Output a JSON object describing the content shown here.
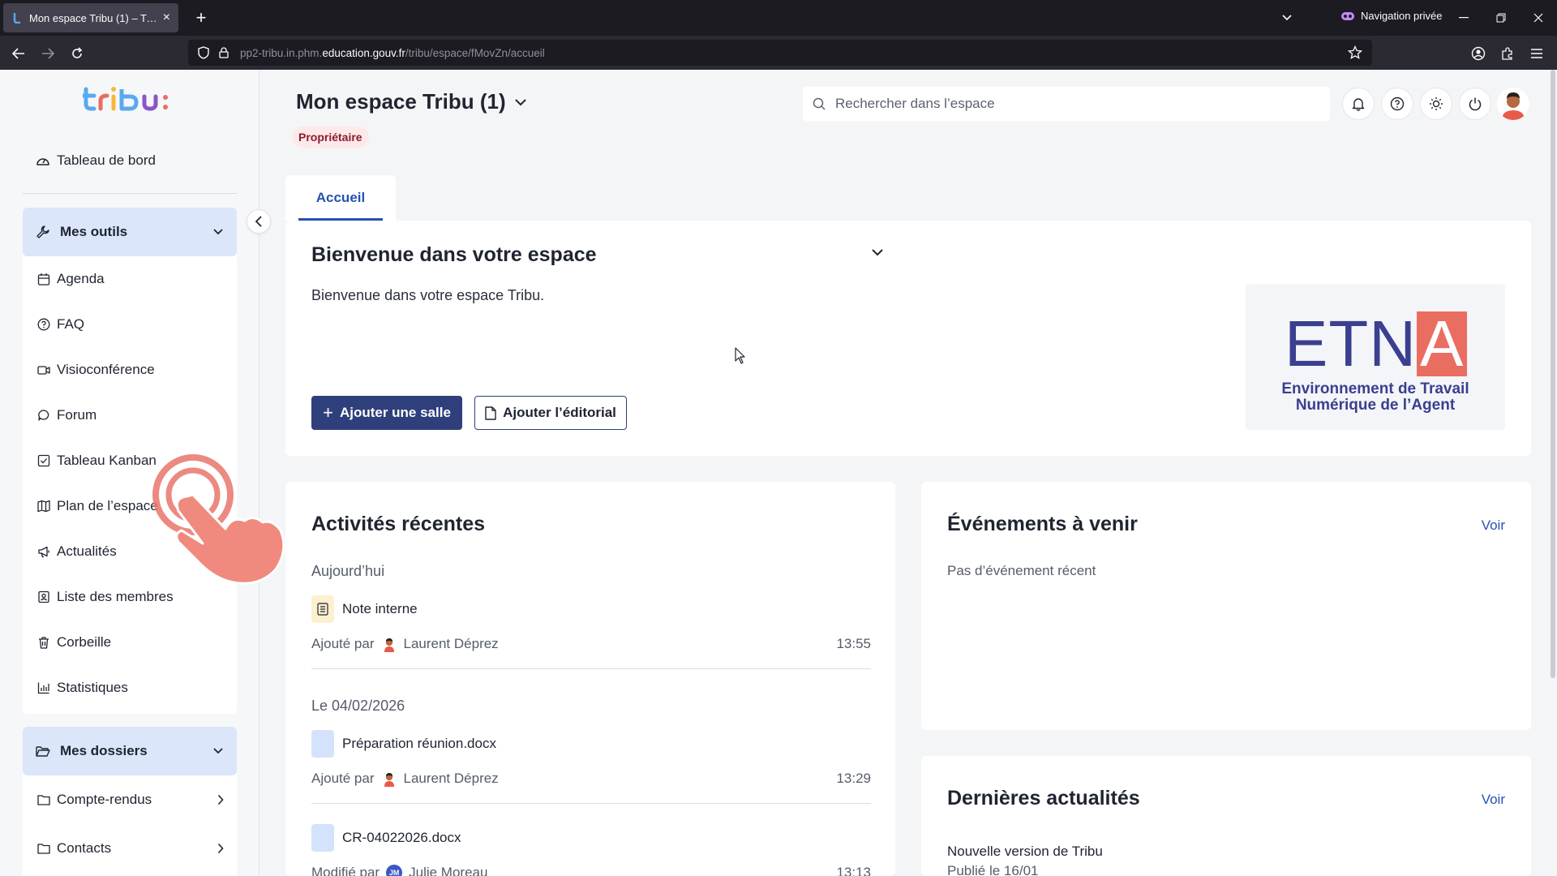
{
  "browser": {
    "tab_title": "Mon espace Tribu (1) – Tribu",
    "url_prefix": "pp2-tribu.in.phm.",
    "url_domain": "education.gouv.fr",
    "url_path": "/tribu/espace/fMovZn/accueil",
    "private_label": "Navigation privée"
  },
  "sidebar": {
    "dashboard_label": "Tableau de bord",
    "tools_header": "Mes outils",
    "tools": [
      {
        "label": "Agenda",
        "icon": "calendar-icon"
      },
      {
        "label": "FAQ",
        "icon": "question-icon"
      },
      {
        "label": "Visioconférence",
        "icon": "video-icon"
      },
      {
        "label": "Forum",
        "icon": "chat-icon"
      },
      {
        "label": "Tableau Kanban",
        "icon": "checkbox-icon"
      },
      {
        "label": "Plan de l’espace",
        "icon": "map-icon"
      },
      {
        "label": "Actualités",
        "icon": "megaphone-icon"
      },
      {
        "label": "Liste des membres",
        "icon": "contact-icon"
      },
      {
        "label": "Corbeille",
        "icon": "trash-icon"
      },
      {
        "label": "Statistiques",
        "icon": "chart-icon"
      }
    ],
    "folders_header": "Mes dossiers",
    "folders": [
      {
        "label": "Compte-rendus"
      },
      {
        "label": "Contacts"
      }
    ]
  },
  "header": {
    "space_title": "Mon espace Tribu (1)",
    "role_badge": "Propriétaire",
    "search_placeholder": "Rechercher dans l’espace"
  },
  "tabs": [
    {
      "label": "Accueil",
      "active": true
    }
  ],
  "welcome": {
    "title": "Bienvenue dans votre espace",
    "text": "Bienvenue dans votre espace Tribu.",
    "add_room_label": "Ajouter une salle",
    "add_editorial_label": "Ajouter l’éditorial",
    "logo_word_main": "ETN",
    "logo_word_accent": "A",
    "logo_sub_line1": "Environnement de Travail",
    "logo_sub_line2": "Numérique de l’Agent"
  },
  "activities": {
    "title": "Activités récentes",
    "groups": [
      {
        "date": "Aujourd’hui",
        "items": [
          {
            "title": "Note interne",
            "action": "Ajouté par",
            "user": "Laurent Déprez",
            "time": "13:55",
            "doc_color": "#fdf0cf"
          }
        ]
      },
      {
        "date": "Le 04/02/2026",
        "items": [
          {
            "title": "Préparation réunion.docx",
            "action": "Ajouté par",
            "user": "Laurent Déprez",
            "time": "13:29",
            "doc_color": "#d3e3fb"
          },
          {
            "title": "CR-04022026.docx",
            "action": "Modifié par",
            "user": "Julie Moreau",
            "user_initials": "JM",
            "time": "13:13",
            "doc_color": "#d3e3fb"
          }
        ]
      }
    ]
  },
  "events": {
    "title": "Événements à venir",
    "link": "Voir",
    "empty": "Pas d’événement récent"
  },
  "news": {
    "title": "Dernières actualités",
    "link": "Voir",
    "item_title": "Nouvelle version de Tribu",
    "item_date": "Publié le 16/01"
  },
  "colors": {
    "primary": "#2f3f7c",
    "accent_link": "#2750b3",
    "sidebar_header": "#dbe6fb",
    "badge_bg": "#fde8ea",
    "etna_blue": "#3a3f8f",
    "etna_red": "#ea6d62"
  }
}
